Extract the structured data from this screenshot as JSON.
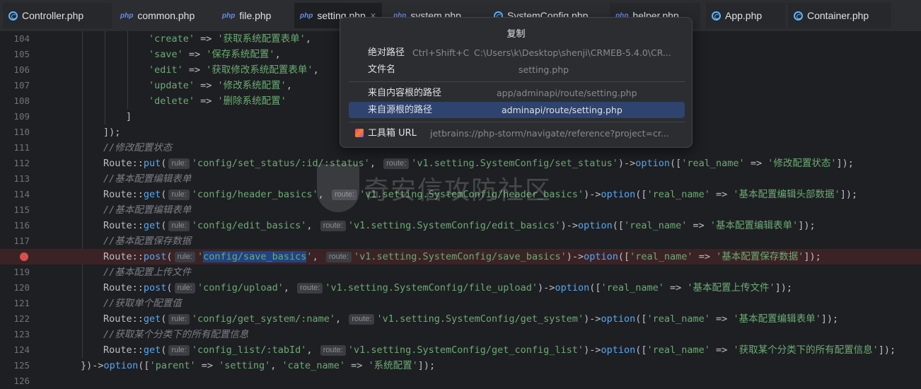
{
  "tabs": [
    {
      "name": "Controller.php",
      "icon": "class-icon"
    },
    {
      "name": "common.php",
      "icon": "php-file-icon"
    },
    {
      "name": "file.php",
      "icon": "php-file-icon"
    },
    {
      "name": "setting.php",
      "icon": "php-file-icon",
      "active": true
    },
    {
      "name": "system.php",
      "icon": "php-file-icon"
    },
    {
      "name": "SystemConfig.php",
      "icon": "class-icon"
    },
    {
      "name": "helper.php",
      "icon": "php-file-icon"
    },
    {
      "name": "App.php",
      "icon": "class-icon"
    },
    {
      "name": "Container.php",
      "icon": "class-icon"
    }
  ],
  "php_icon_text": "php",
  "hint_rule": "rule:",
  "hint_route": "route:",
  "gutter": {
    "lines": [
      "104",
      "105",
      "106",
      "107",
      "108",
      "109",
      "110",
      "111",
      "112",
      "113",
      "114",
      "115",
      "116",
      "117",
      "118",
      "119",
      "120",
      "121",
      "122",
      "123",
      "124",
      "125",
      "126"
    ],
    "breakpoint_line": "118"
  },
  "code": {
    "l104": {
      "k": "'create'",
      "v": "'获取系统配置表单'"
    },
    "l105": {
      "k": "'save'",
      "v": "'保存系统配置'"
    },
    "l106": {
      "k": "'edit'",
      "v": "'获取修改系统配置表单'"
    },
    "l107": {
      "k": "'update'",
      "v": "'修改系统配置'"
    },
    "l108": {
      "k": "'delete'",
      "v": "'删除系统配置'"
    },
    "l109": "]",
    "l110": "]);",
    "l111": "//修改配置状态",
    "l112": {
      "m": "put",
      "rule": "'config/set_status/:id/:status'",
      "route": "'v1.setting.SystemConfig/set_status'",
      "name": "'修改配置状态'"
    },
    "l113": "//基本配置编辑表单",
    "l114": {
      "m": "get",
      "rule": "'config/header_basics'",
      "route": "'v1.setting.SystemConfig/header_basics'",
      "name": "'基本配置编辑头部数据'"
    },
    "l115": "//基本配置编辑表单",
    "l116": {
      "m": "get",
      "rule": "'config/edit_basics'",
      "route": "'v1.setting.SystemConfig/edit_basics'",
      "name": "'基本配置编辑表单'"
    },
    "l117": "//基本配置保存数据",
    "l118": {
      "m": "post",
      "rule_sel": "config/save_basics",
      "route": "'v1.setting.SystemConfig/save_basics'",
      "name": "'基本配置保存数据'"
    },
    "l119": "//基本配置上传文件",
    "l120": {
      "m": "post",
      "rule": "'config/upload'",
      "route": "'v1.setting.SystemConfig/file_upload'",
      "name": "'基本配置上传文件'"
    },
    "l121": "//获取单个配置值",
    "l122": {
      "m": "get",
      "rule": "'config/get_system/:name'",
      "route": "'v1.setting.SystemConfig/get_system'",
      "name": "'基本配置编辑表单'"
    },
    "l123": "//获取某个分类下的所有配置信息",
    "l124": {
      "m": "get",
      "rule": "'config_list/:tabId'",
      "route": "'v1.setting.SystemConfig/get_config_list'",
      "name": "'获取某个分类下的所有配置信息'"
    },
    "l125": {
      "parent": "'setting'",
      "cate": "'系统配置'"
    },
    "tok": {
      "route": "Route",
      "dcolon": "::",
      "paren_open": "(",
      "arrow": " => ",
      "comma": ",",
      "option": "option",
      "close_route": ")->",
      "open_arr": "([",
      "real_name": "'real_name'",
      "end": "]);",
      "l125_start": "})->",
      "parent_key": "'parent'",
      "cate_key": "'cate_name'"
    }
  },
  "popup": {
    "title": "复制",
    "items": [
      {
        "label": "绝对路径",
        "shortcut": "Ctrl+Shift+C",
        "value": "C:\\Users\\k\\Desktop\\shenji\\CRMEB-5.4.0\\CR..."
      },
      {
        "label": "文件名",
        "value": "setting.php"
      },
      {
        "label": "来自内容根的路径",
        "value": "app/adminapi/route/setting.php"
      },
      {
        "label": "来自源根的路径",
        "value": "adminapi/route/setting.php",
        "selected": true
      },
      {
        "label": "工具箱 URL",
        "value": "jetbrains://php-storm/navigate/reference?project=cr..."
      }
    ]
  },
  "watermark": {
    "text": "奇安信攻防社区"
  }
}
